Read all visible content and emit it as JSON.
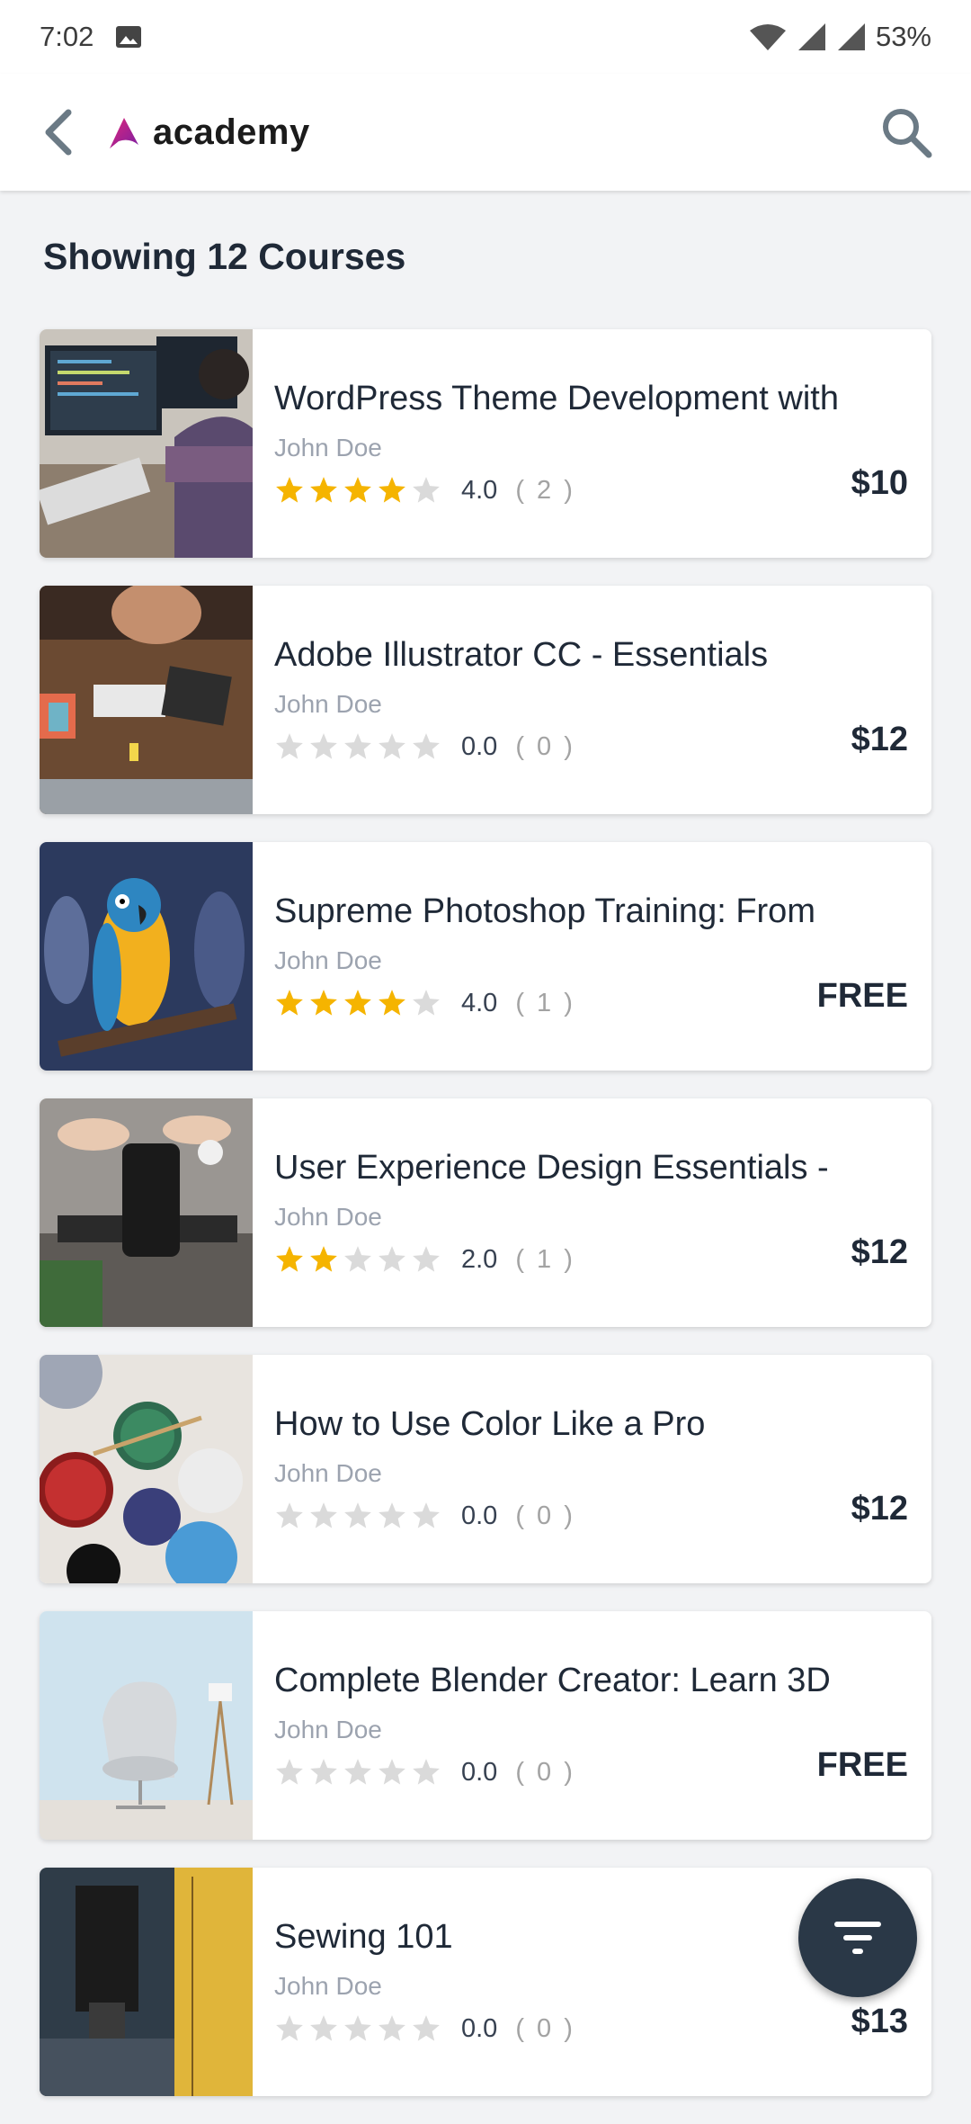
{
  "status_bar": {
    "time": "7:02",
    "battery": "53%"
  },
  "app_bar": {
    "logo_text": "academy"
  },
  "heading": "Showing 12 Courses",
  "courses": [
    {
      "title": "WordPress Theme Development with",
      "author": "John Doe",
      "rating": 4,
      "rating_text": "4.0",
      "count_text": "( 2 )",
      "price": "$10",
      "thumb": "coding"
    },
    {
      "title": "Adobe Illustrator CC - Essentials",
      "author": "John Doe",
      "rating": 0,
      "rating_text": "0.0",
      "count_text": "( 0 )",
      "price": "$12",
      "thumb": "desk"
    },
    {
      "title": "Supreme Photoshop Training: From",
      "author": "John Doe",
      "rating": 4,
      "rating_text": "4.0",
      "count_text": "( 1 )",
      "price": "FREE",
      "thumb": "parrot"
    },
    {
      "title": "User Experience Design Essentials -",
      "author": "John Doe",
      "rating": 2,
      "rating_text": "2.0",
      "count_text": "( 1 )",
      "price": "$12",
      "thumb": "phone"
    },
    {
      "title": "How to Use Color Like a Pro",
      "author": "John Doe",
      "rating": 0,
      "rating_text": "0.0",
      "count_text": "( 0 )",
      "price": "$12",
      "thumb": "paint"
    },
    {
      "title": "Complete Blender Creator: Learn 3D",
      "author": "John Doe",
      "rating": 0,
      "rating_text": "0.0",
      "count_text": "( 0 )",
      "price": "FREE",
      "thumb": "chair"
    },
    {
      "title": "Sewing 101",
      "author": "John Doe",
      "rating": 0,
      "rating_text": "0.0",
      "count_text": "( 0 )",
      "price": "$13",
      "thumb": "sewing"
    }
  ],
  "colors": {
    "star_filled": "#f5b400",
    "star_empty": "#dadada",
    "fab_bg": "#2a3847",
    "logo_accent": "#c2187a"
  },
  "icons": {
    "back": "chevron-left-icon",
    "search": "search-icon",
    "filter": "filter-icon"
  }
}
